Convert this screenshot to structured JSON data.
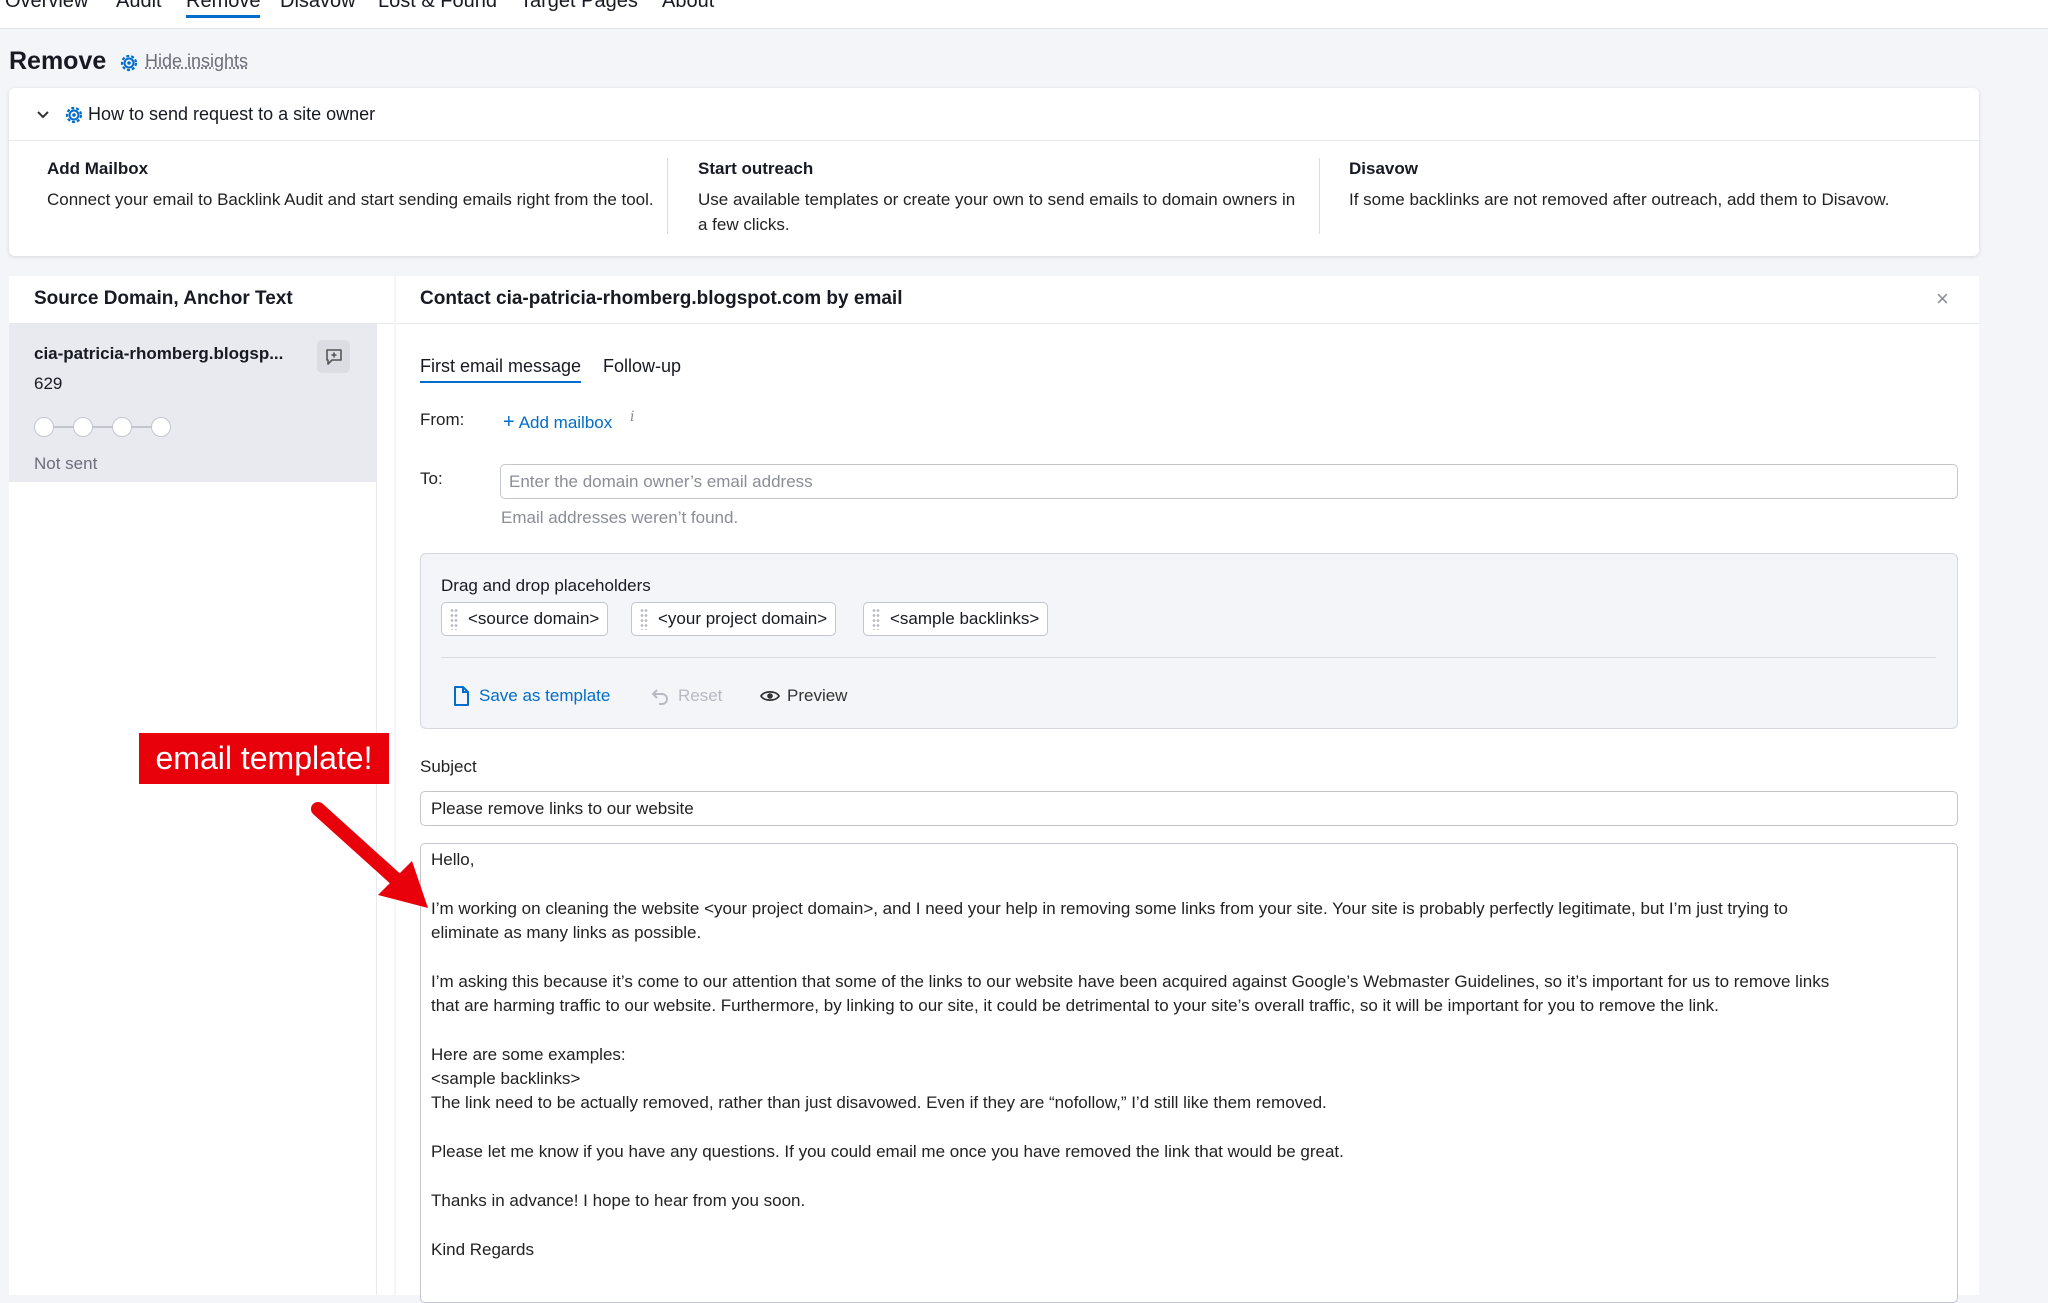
{
  "nav": {
    "tabs": [
      "Overview",
      "Audit",
      "Remove",
      "Disavow",
      "Lost & Found",
      "Target Pages",
      "About"
    ],
    "active": "Remove"
  },
  "page": {
    "title": "Remove",
    "hide_insights": "Hide insights"
  },
  "insights": {
    "heading": "How to send request to a site owner",
    "cards": [
      {
        "title": "Add Mailbox",
        "text": "Connect your email to Backlink Audit and start sending emails right from the tool."
      },
      {
        "title": "Start outreach",
        "text": "Use available templates or create your own to send emails to domain owners in a few clicks."
      },
      {
        "title": "Disavow",
        "text": "If some backlinks are not removed after outreach, add them to Disavow."
      }
    ]
  },
  "left_panel": {
    "header": "Source Domain, Anchor Text",
    "item": {
      "domain": "cia-patricia-rhomberg.blogsp...",
      "count": "629",
      "status": "Not sent"
    }
  },
  "main_panel": {
    "header": "Contact cia-patricia-rhomberg.blogspot.com by email",
    "tabs": [
      "First email message",
      "Follow-up"
    ],
    "from_label": "From:",
    "add_mailbox": "Add mailbox",
    "info": "i",
    "to_label": "To:",
    "to_placeholder": "Enter the domain owner’s email address",
    "to_hint": "Email addresses weren’t found.",
    "placeholders": {
      "title": "Drag and drop placeholders",
      "chips": [
        "<source domain>",
        "<your project domain>",
        "<sample backlinks>"
      ],
      "save_template": "Save as template",
      "reset": "Reset",
      "preview": "Preview"
    },
    "subject_label": "Subject",
    "subject_value": "Please remove links to our website",
    "body_lines": [
      "Hello,",
      "I’m working on cleaning the website <your project domain>, and I need your help in removing some links from your site. Your site is probably perfectly legitimate, but I’m just trying to",
      "eliminate as many links as possible.",
      "I’m asking this because it’s come to our attention that some of the links to our website have been acquired against Google’s Webmaster Guidelines, so it’s important for us to remove links",
      "that are harming traffic to our website. Furthermore, by linking to our site, it could be detrimental to your site’s overall traffic, so it will be important for you to remove the link.",
      "Here are some examples:",
      "<sample backlinks>",
      "The link need to be actually removed, rather than just disavowed. Even if they are “nofollow,” I’d still like them removed.",
      "Please let me know if you have any questions. If you could email me once you have removed the link that would be great.",
      "Thanks in advance! I hope to hear from you soon.",
      "Kind Regards"
    ]
  },
  "annotation": {
    "label": "email template!",
    "color": "#e8000b"
  },
  "colors": {
    "accent": "#006dca",
    "background": "#f4f5f9"
  }
}
